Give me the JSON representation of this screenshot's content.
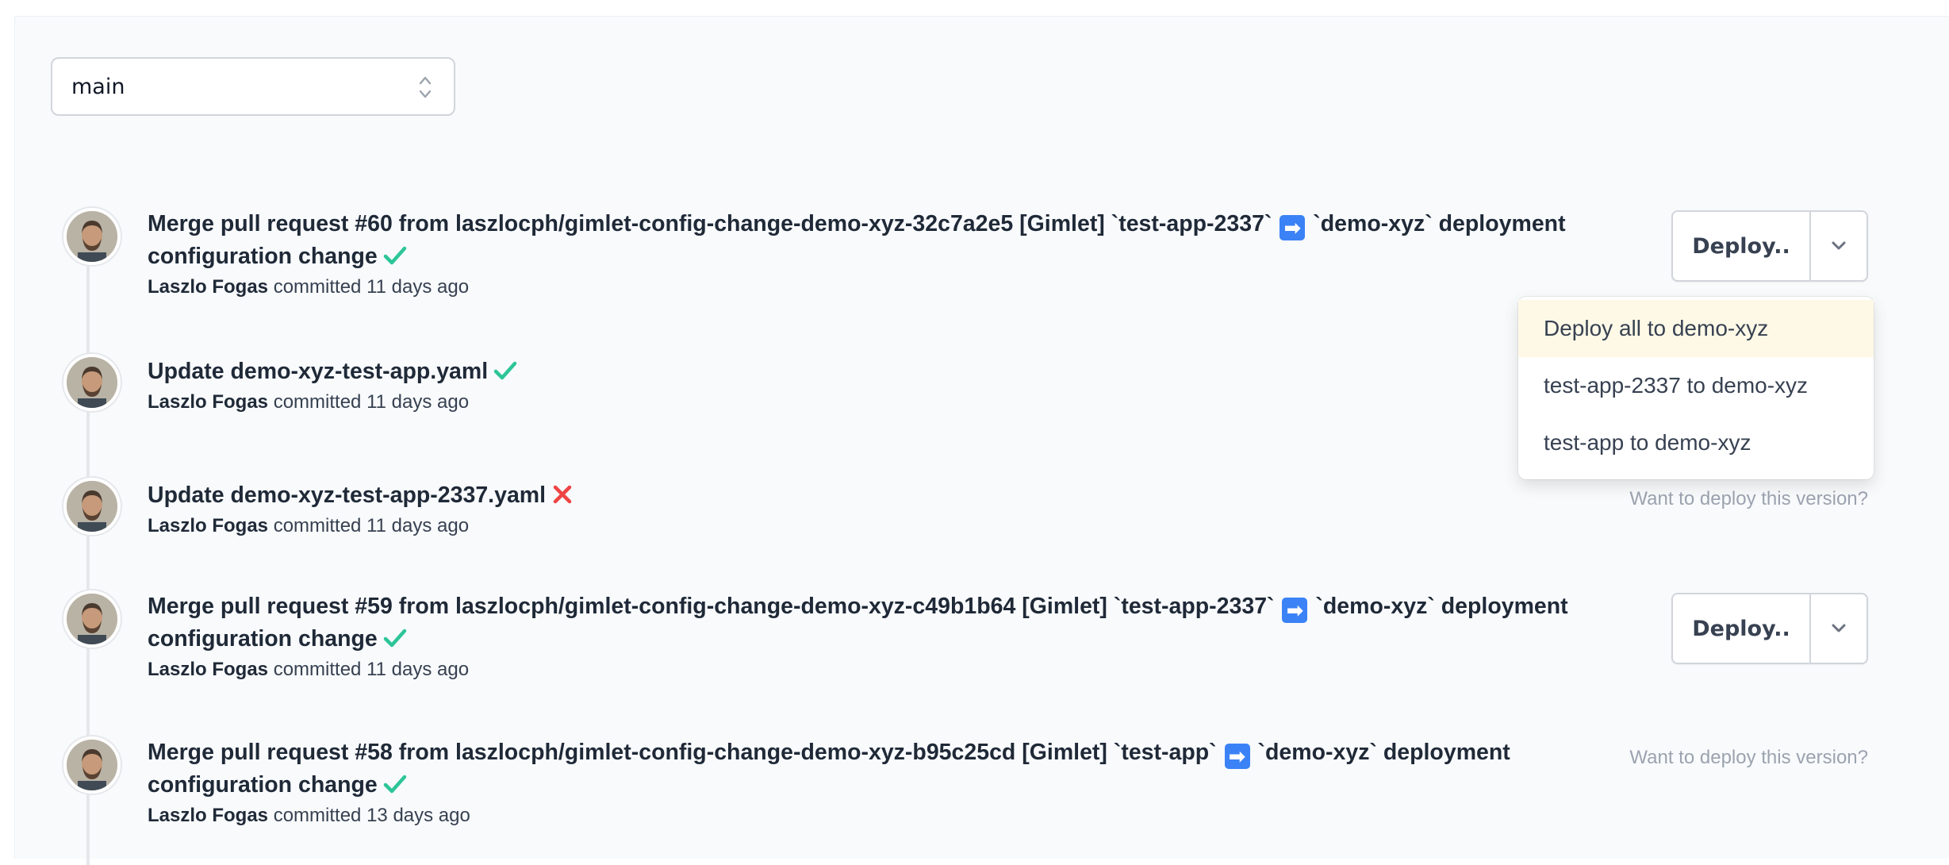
{
  "branch": {
    "value": "main"
  },
  "colors": {
    "check": "#2dc598",
    "cross": "#ef4444",
    "arrow_emoji": "#3b82f6"
  },
  "commits": [
    {
      "title_before": "Merge pull request #60 from laszlocph/gimlet-config-change-demo-xyz-32c7a2e5 [Gimlet] `test-app-2337`",
      "title_after": "`demo-xyz` deployment configuration change",
      "status": "success",
      "author": "Laszlo Fogas",
      "committed_label": "committed",
      "age": "11 days ago",
      "deploy_label": "Deploy.."
    },
    {
      "title": "Update demo-xyz-test-app.yaml",
      "status": "success",
      "author": "Laszlo Fogas",
      "committed_label": "committed",
      "age": "11 days ago"
    },
    {
      "title": "Update demo-xyz-test-app-2337.yaml",
      "status": "failure",
      "author": "Laszlo Fogas",
      "committed_label": "committed",
      "age": "11 days ago",
      "hint": "Want to deploy this version?"
    },
    {
      "title_before": "Merge pull request #59 from laszlocph/gimlet-config-change-demo-xyz-c49b1b64 [Gimlet] `test-app-2337`",
      "title_after": "`demo-xyz` deployment configuration change",
      "status": "success",
      "author": "Laszlo Fogas",
      "committed_label": "committed",
      "age": "11 days ago",
      "deploy_label": "Deploy.."
    },
    {
      "title_before": "Merge pull request #58 from laszlocph/gimlet-config-change-demo-xyz-b95c25cd [Gimlet] `test-app`",
      "title_after": "`demo-xyz` deployment configuration change",
      "status": "success",
      "author": "Laszlo Fogas",
      "committed_label": "committed",
      "age": "13 days ago",
      "hint": "Want to deploy this version?"
    }
  ],
  "deploy_menu": {
    "items": [
      {
        "label": "Deploy all to demo-xyz",
        "active": true
      },
      {
        "label": "test-app-2337 to demo-xyz",
        "active": false
      },
      {
        "label": "test-app to demo-xyz",
        "active": false
      }
    ]
  }
}
